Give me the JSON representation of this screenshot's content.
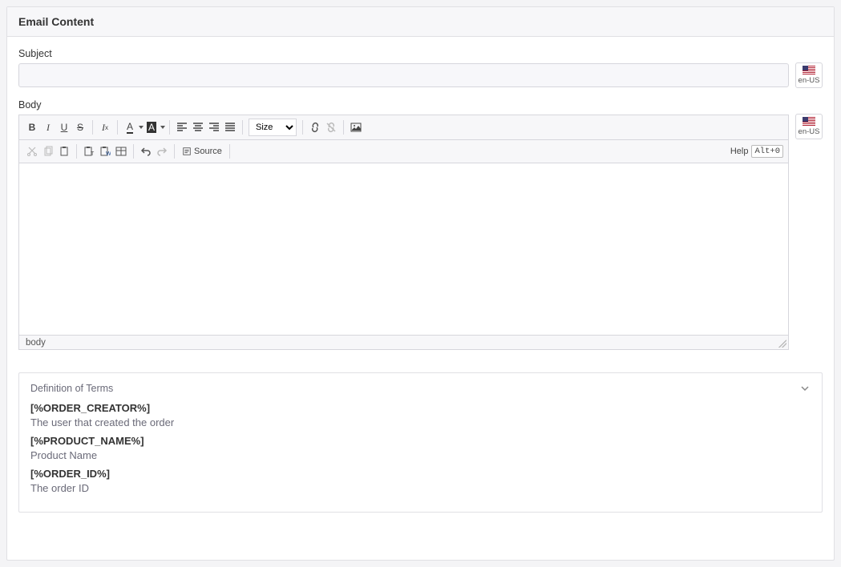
{
  "header": {
    "title": "Email Content"
  },
  "subject": {
    "label": "Subject",
    "value": "",
    "placeholder": ""
  },
  "body": {
    "label": "Body"
  },
  "locale": {
    "code": "en-US"
  },
  "editor": {
    "size_label": "Size",
    "help_label": "Help",
    "help_shortcut": "Alt+0",
    "source_label": "Source",
    "path": "body"
  },
  "terms": {
    "header": "Definition of Terms",
    "items": [
      {
        "token": "[%ORDER_CREATOR%]",
        "desc": "The user that created the order"
      },
      {
        "token": "[%PRODUCT_NAME%]",
        "desc": "Product Name"
      },
      {
        "token": "[%ORDER_ID%]",
        "desc": "The order ID"
      }
    ]
  }
}
